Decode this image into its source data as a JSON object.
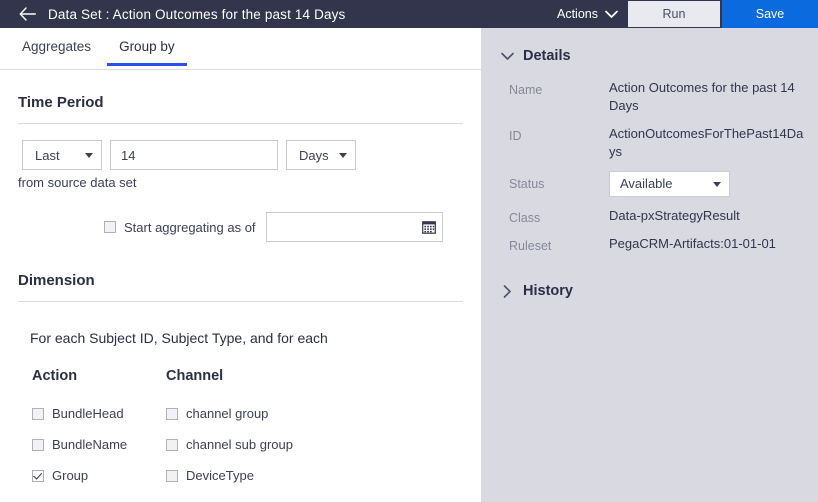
{
  "topbar": {
    "back_icon": "arrow-left-icon",
    "prefix": "Data Set",
    "separator": ":",
    "title": "Action Outcomes for the past 14 Days",
    "full_title": "Data Set : Action Outcomes for the past 14 Days",
    "actions_label": "Actions",
    "actions_caret_icon": "chevron-down-icon",
    "run_label": "Run",
    "save_label": "Save",
    "background_color": "#32354c",
    "save_color": "#0b6ade",
    "run_color": "#e9eaef"
  },
  "tabs": [
    {
      "label": "Aggregates",
      "active": false
    },
    {
      "label": "Group by",
      "active": true
    }
  ],
  "tab_accent_color": "#2b50ea",
  "time_period": {
    "heading": "Time Period",
    "range_mode": "Last",
    "range_value": "14",
    "range_unit": "Days",
    "source_text": "from source data set",
    "start_aggregating": {
      "label": "Start aggregating as of",
      "checked": false,
      "date_value": "",
      "date_placeholder": "",
      "calendar_icon": "calendar-icon"
    }
  },
  "dimension": {
    "heading": "Dimension",
    "for_each_text": "For each Subject ID, Subject Type, and for each",
    "columns": [
      {
        "header": "Action",
        "options": [
          {
            "label": "BundleHead",
            "checked": false
          },
          {
            "label": "BundleName",
            "checked": false
          },
          {
            "label": "Group",
            "checked": true
          }
        ]
      },
      {
        "header": "Channel",
        "options": [
          {
            "label": "channel group",
            "checked": false
          },
          {
            "label": "channel sub group",
            "checked": false
          },
          {
            "label": "DeviceType",
            "checked": false
          }
        ]
      }
    ]
  },
  "right_panel": {
    "background_color": "#d9dae1",
    "details": {
      "title": "Details",
      "expanded": true,
      "twisty_icon": "chevron-down-icon",
      "fields": [
        {
          "label": "Name",
          "value": "Action Outcomes for the past 14 Days",
          "type": "text"
        },
        {
          "label": "ID",
          "value": "ActionOutcomesForThePast14Days",
          "type": "text"
        },
        {
          "label": "Status",
          "value": "Available",
          "type": "select"
        },
        {
          "label": "Class",
          "value": "Data-pxStrategyResult",
          "type": "text"
        },
        {
          "label": "Ruleset",
          "value": "PegaCRM-Artifacts:01-01-01",
          "type": "text"
        }
      ]
    },
    "history": {
      "title": "History",
      "expanded": false,
      "twisty_icon": "chevron-right-icon"
    }
  }
}
